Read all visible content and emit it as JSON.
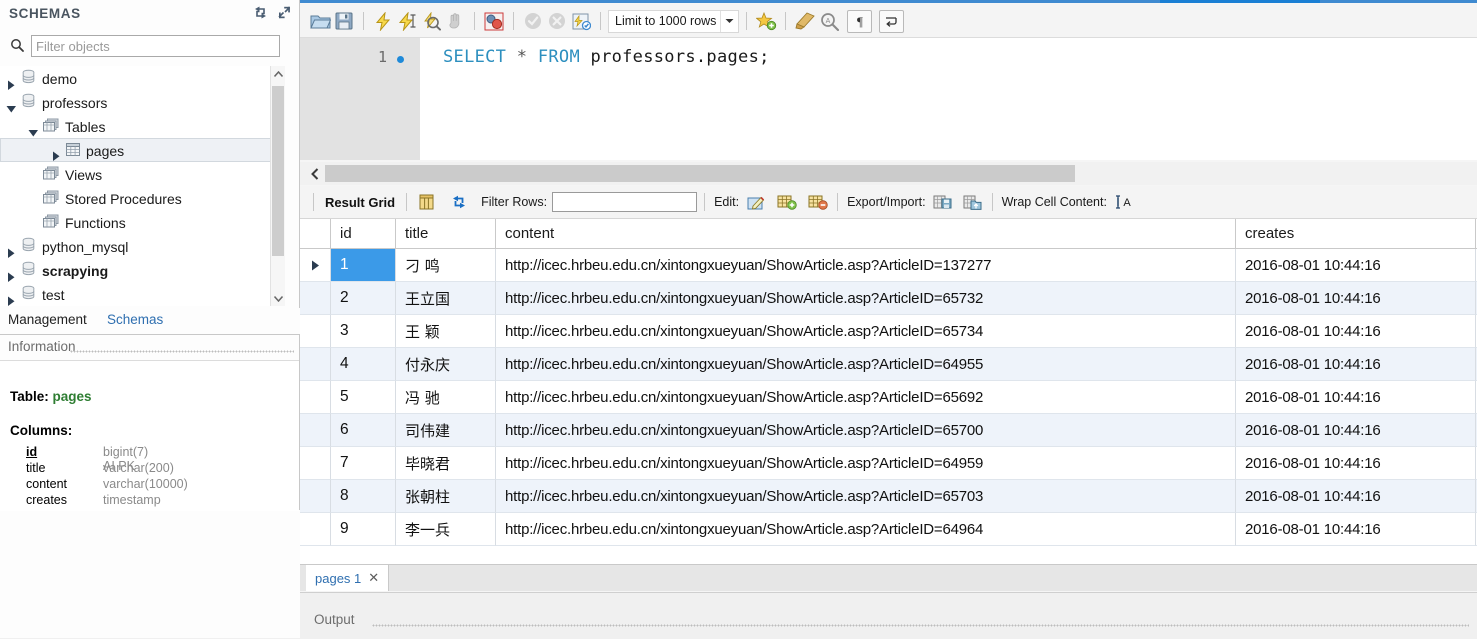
{
  "sidebar": {
    "title": "SCHEMAS",
    "refresh_icon": "refresh-icon",
    "collapse_icon": "collapse-icon",
    "search_icon": "search-icon",
    "filter_placeholder": "Filter objects",
    "filter_value": "",
    "tree": [
      {
        "label": "demo",
        "icon": "schema-icon",
        "indent": 0,
        "expander": "collapsed",
        "selected": false,
        "bold": false
      },
      {
        "label": "professors",
        "icon": "schema-icon",
        "indent": 0,
        "expander": "expanded",
        "selected": false,
        "bold": false
      },
      {
        "label": "Tables",
        "icon": "folder-icon",
        "indent": 1,
        "expander": "expanded",
        "selected": false,
        "bold": false
      },
      {
        "label": "pages",
        "icon": "table-icon",
        "indent": 2,
        "expander": "collapsed",
        "selected": true,
        "bold": false
      },
      {
        "label": "Views",
        "icon": "folder-icon",
        "indent": 1,
        "expander": "none",
        "selected": false,
        "bold": false
      },
      {
        "label": "Stored Procedures",
        "icon": "folder-icon",
        "indent": 1,
        "expander": "none",
        "selected": false,
        "bold": false
      },
      {
        "label": "Functions",
        "icon": "folder-icon",
        "indent": 1,
        "expander": "none",
        "selected": false,
        "bold": false
      },
      {
        "label": "python_mysql",
        "icon": "schema-icon",
        "indent": 0,
        "expander": "collapsed",
        "selected": false,
        "bold": false
      },
      {
        "label": "scrapying",
        "icon": "schema-icon",
        "indent": 0,
        "expander": "collapsed",
        "selected": false,
        "bold": true
      },
      {
        "label": "test",
        "icon": "schema-icon",
        "indent": 0,
        "expander": "collapsed",
        "selected": false,
        "bold": false
      }
    ],
    "tabs": [
      {
        "label": "Management",
        "active": false
      },
      {
        "label": "Schemas",
        "active": true
      }
    ],
    "information": {
      "header": "Information",
      "table_label": "Table:",
      "table_name": "pages",
      "columns_label": "Columns:",
      "columns": [
        {
          "name": "id",
          "type": "bigint(7) AI PK",
          "pk": true
        },
        {
          "name": "title",
          "type": "varchar(200)",
          "pk": false
        },
        {
          "name": "content",
          "type": "varchar(10000)",
          "pk": false
        },
        {
          "name": "creates",
          "type": "timestamp",
          "pk": false
        }
      ]
    }
  },
  "toolbar": {
    "icons": [
      "open-script-icon",
      "save-script-icon",
      "execute-icon",
      "execute-current-icon",
      "explain-icon",
      "stop-icon",
      "toggle-commit-icon",
      "commit-icon",
      "rollback-icon",
      "auto-commit-icon"
    ],
    "limit_label": "Limit to 1000 rows",
    "limit_caret": "chevron-down-icon",
    "right_icons": [
      "new-snippet-icon",
      "beautify-icon",
      "find-icon",
      "invisible-chars-icon",
      "wrap-lines-icon"
    ]
  },
  "editor": {
    "line_number": "1",
    "sql_tokens": [
      {
        "text": "SELECT",
        "type": "keyword"
      },
      {
        "text": " ",
        "type": "plain"
      },
      {
        "text": "*",
        "type": "operator"
      },
      {
        "text": " ",
        "type": "plain"
      },
      {
        "text": "FROM",
        "type": "keyword"
      },
      {
        "text": " ",
        "type": "plain"
      },
      {
        "text": "professors.pages;",
        "type": "identifier"
      }
    ],
    "sql_text": "SELECT * FROM professors.pages;"
  },
  "result_toolbar": {
    "result_grid_label": "Result Grid",
    "grid_view_icon": "grid-view-icon",
    "refresh_icon": "refresh-grid-icon",
    "filter_rows_label": "Filter Rows:",
    "filter_rows_value": "",
    "edit_label": "Edit:",
    "edit_icons": [
      "edit-cell-icon",
      "insert-row-icon",
      "delete-row-icon"
    ],
    "export_label": "Export/Import:",
    "export_icons": [
      "export-icon",
      "import-icon"
    ],
    "wrap_label": "Wrap Cell Content:",
    "wrap_icon": "wrap-cell-icon"
  },
  "grid": {
    "columns": [
      "id",
      "title",
      "content",
      "creates"
    ],
    "rows": [
      {
        "id": "1",
        "title": "刁 鸣",
        "content": "http://icec.hrbeu.edu.cn/xintongxueyuan/ShowArticle.asp?ArticleID=137277",
        "creates": "2016-08-01 10:44:16",
        "current": true
      },
      {
        "id": "2",
        "title": "王立国",
        "content": "http://icec.hrbeu.edu.cn/xintongxueyuan/ShowArticle.asp?ArticleID=65732",
        "creates": "2016-08-01 10:44:16",
        "current": false
      },
      {
        "id": "3",
        "title": "王 颖",
        "content": "http://icec.hrbeu.edu.cn/xintongxueyuan/ShowArticle.asp?ArticleID=65734",
        "creates": "2016-08-01 10:44:16",
        "current": false
      },
      {
        "id": "4",
        "title": "付永庆",
        "content": "http://icec.hrbeu.edu.cn/xintongxueyuan/ShowArticle.asp?ArticleID=64955",
        "creates": "2016-08-01 10:44:16",
        "current": false
      },
      {
        "id": "5",
        "title": "冯 驰",
        "content": "http://icec.hrbeu.edu.cn/xintongxueyuan/ShowArticle.asp?ArticleID=65692",
        "creates": "2016-08-01 10:44:16",
        "current": false
      },
      {
        "id": "6",
        "title": "司伟建",
        "content": "http://icec.hrbeu.edu.cn/xintongxueyuan/ShowArticle.asp?ArticleID=65700",
        "creates": "2016-08-01 10:44:16",
        "current": false
      },
      {
        "id": "7",
        "title": "毕晓君",
        "content": "http://icec.hrbeu.edu.cn/xintongxueyuan/ShowArticle.asp?ArticleID=64959",
        "creates": "2016-08-01 10:44:16",
        "current": false
      },
      {
        "id": "8",
        "title": "张朝柱",
        "content": "http://icec.hrbeu.edu.cn/xintongxueyuan/ShowArticle.asp?ArticleID=65703",
        "creates": "2016-08-01 10:44:16",
        "current": false
      },
      {
        "id": "9",
        "title": "李一兵",
        "content": "http://icec.hrbeu.edu.cn/xintongxueyuan/ShowArticle.asp?ArticleID=64964",
        "creates": "2016-08-01 10:44:16",
        "current": false
      }
    ]
  },
  "result_tab": {
    "label": "pages 1",
    "close_icon": "close-icon"
  },
  "output": {
    "header": "Output"
  },
  "colors": {
    "accent": "#3f8ad0",
    "selection": "#3b9ae8",
    "alt_row": "#eef3fa",
    "keyword": "#2d8fbf",
    "link": "#2f6fb0",
    "table_name": "#2e7d32"
  }
}
